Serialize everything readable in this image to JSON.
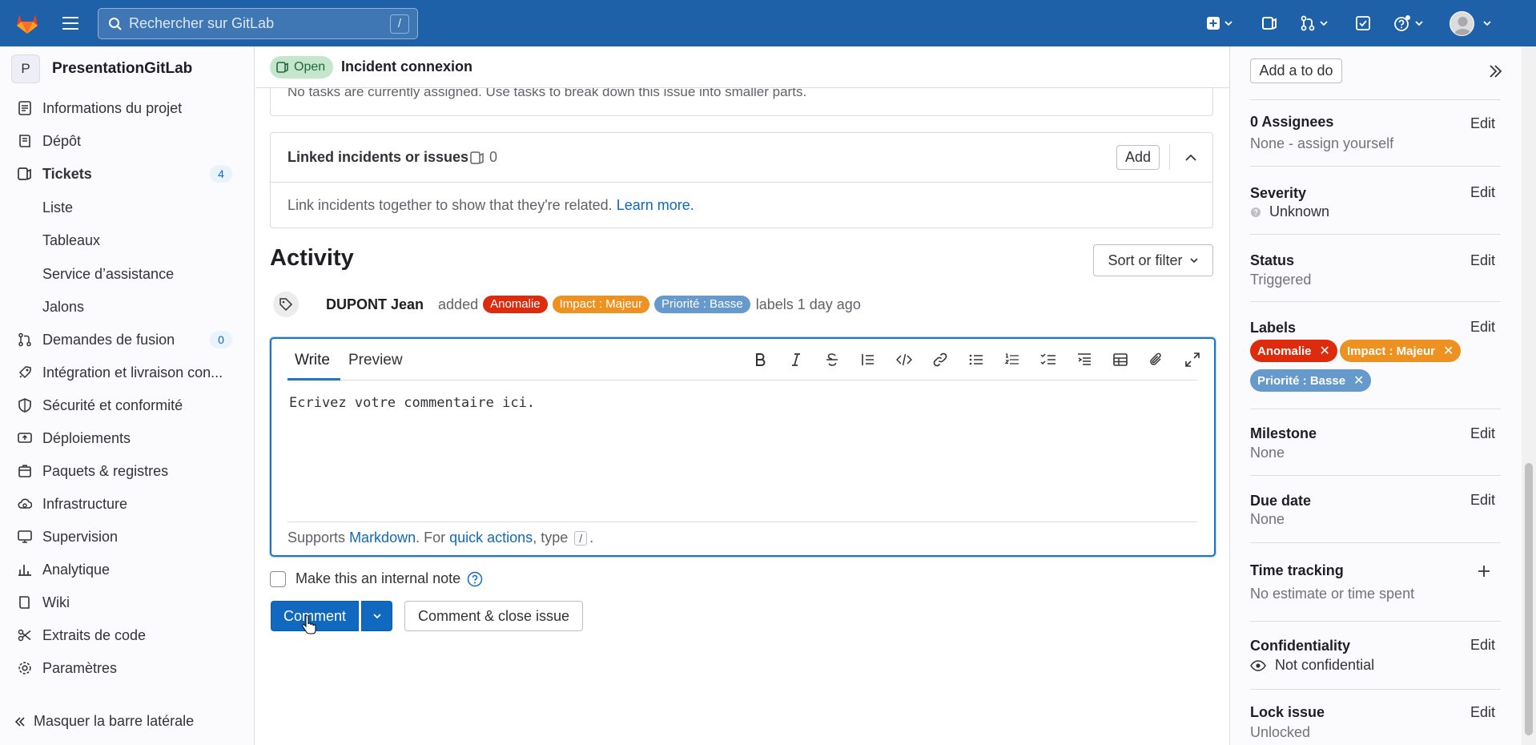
{
  "topbar": {
    "search_placeholder": "Rechercher sur GitLab",
    "search_shortcut": "/"
  },
  "sidebar": {
    "project_initial": "P",
    "project_name": "PresentationGitLab",
    "items": [
      {
        "label": "Informations du projet",
        "icon": "project-info-icon"
      },
      {
        "label": "Dépôt",
        "icon": "repository-icon"
      },
      {
        "label": "Tickets",
        "icon": "issues-icon",
        "count": "4"
      },
      {
        "label": "Demandes de fusion",
        "icon": "merge-request-icon",
        "count": "0"
      },
      {
        "label": "Intégration et livraison con...",
        "icon": "rocket-icon"
      },
      {
        "label": "Sécurité et conformité",
        "icon": "shield-icon"
      },
      {
        "label": "Déploiements",
        "icon": "deployments-icon"
      },
      {
        "label": "Paquets & registres",
        "icon": "package-icon"
      },
      {
        "label": "Infrastructure",
        "icon": "cloud-icon"
      },
      {
        "label": "Supervision",
        "icon": "monitor-icon"
      },
      {
        "label": "Analytique",
        "icon": "chart-icon"
      },
      {
        "label": "Wiki",
        "icon": "book-icon"
      },
      {
        "label": "Extraits de code",
        "icon": "snippet-icon"
      },
      {
        "label": "Paramètres",
        "icon": "gear-icon"
      }
    ],
    "tickets_sub": [
      "Liste",
      "Tableaux",
      "Service d’assistance",
      "Jalons"
    ],
    "collapse_label": "Masquer la barre latérale"
  },
  "issue": {
    "status": "Open",
    "title": "Incident connexion"
  },
  "tasks": {
    "empty_text": "No tasks are currently assigned. Use tasks to break down this issue into smaller parts."
  },
  "linked": {
    "title": "Linked incidents or issues",
    "count": "0",
    "add_label": "Add",
    "body_text": "Link incidents together to show that they're related.",
    "learn_more": "Learn more."
  },
  "activity": {
    "title": "Activity",
    "sort_label": "Sort or filter",
    "event": {
      "author": "DUPONT Jean",
      "verb": "added",
      "labels": [
        {
          "name": "Anomalie",
          "color": "#dd2b0e"
        },
        {
          "name": "Impact : Majeur",
          "color": "#ed9121"
        },
        {
          "name": "Priorité : Basse",
          "color": "#6699cc"
        }
      ],
      "tail": "labels 1 day ago"
    }
  },
  "editor": {
    "tab_write": "Write",
    "tab_preview": "Preview",
    "text": "Ecrivez votre commentaire ici.",
    "footer_supports": "Supports",
    "footer_markdown": "Markdown",
    "footer_for": ". For",
    "footer_quick": "quick actions",
    "footer_type": ", type",
    "footer_kbd": "/",
    "footer_end": ".",
    "internal_note": "Make this an internal note"
  },
  "actions": {
    "comment": "Comment",
    "comment_close": "Comment & close issue"
  },
  "right_sidebar": {
    "todo": "Add a to do",
    "edit": "Edit",
    "assignees_title": "0 Assignees",
    "assignees_value": "None - assign yourself",
    "severity_title": "Severity",
    "severity_value": "Unknown",
    "status_title": "Status",
    "status_value": "Triggered",
    "labels_title": "Labels",
    "labels": [
      {
        "name": "Anomalie",
        "color": "#dd2b0e"
      },
      {
        "name": "Impact : Majeur",
        "color": "#ed9121"
      },
      {
        "name": "Priorité : Basse",
        "color": "#6699cc"
      }
    ],
    "milestone_title": "Milestone",
    "milestone_value": "None",
    "due_title": "Due date",
    "due_value": "None",
    "time_title": "Time tracking",
    "time_value": "No estimate or time spent",
    "conf_title": "Confidentiality",
    "conf_value": "Not confidential",
    "lock_title": "Lock issue",
    "lock_value": "Unlocked"
  }
}
